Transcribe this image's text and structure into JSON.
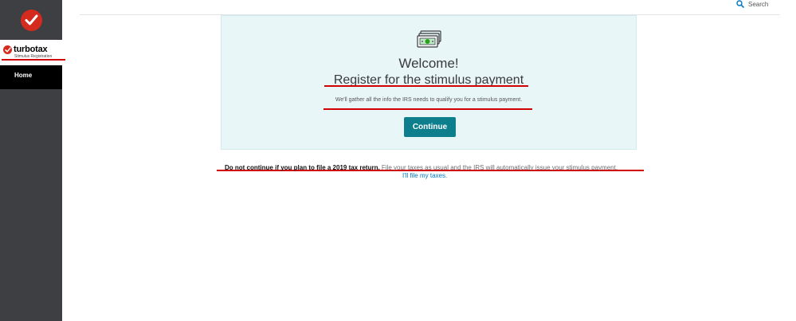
{
  "search": {
    "label": "Search",
    "icon": "search-icon"
  },
  "sidebar": {
    "brand_name": "turbotax",
    "brand_subtitle": "Stimulus Registration",
    "nav_items": [
      {
        "label": "Home"
      }
    ]
  },
  "main": {
    "icon": "money-icon",
    "welcome": "Welcome!",
    "heading": "Register for the stimulus payment",
    "description": "We'll gather all the info the IRS needs to qualify you for a stimulus payment.",
    "continue_label": "Continue"
  },
  "notice": {
    "bold": "Do not continue if you plan to file a 2019 tax return.",
    "rest": " File your taxes as usual and the IRS will automatically issue your stimulus payment.",
    "link": "I'll file my taxes."
  },
  "colors": {
    "brand_red": "#d52b1e",
    "sidebar_bg": "#3d3f42",
    "accent_teal": "#0d7e8c",
    "card_bg": "#e9f6f8",
    "annotation_red": "#d00000"
  }
}
